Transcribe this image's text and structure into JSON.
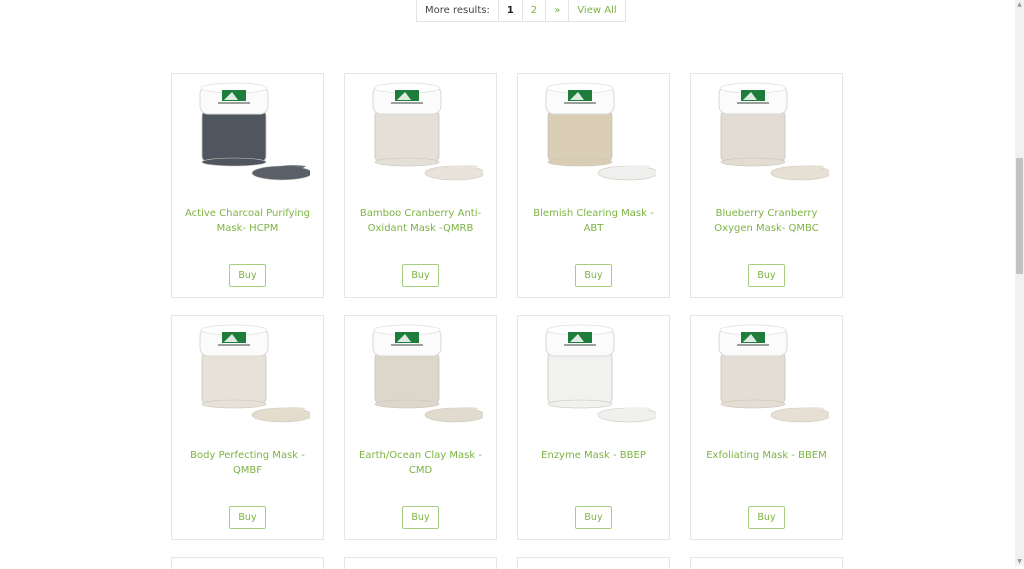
{
  "pager": {
    "label": "More results:",
    "current": "1",
    "page2": "2",
    "next": "»",
    "view_all": "View All"
  },
  "products": [
    {
      "title": "Active Charcoal Purifying Mask- HCPM",
      "buy": "Buy",
      "jar_color": "#4f5660",
      "swatch_color": "#5a6068"
    },
    {
      "title": "Bamboo Cranberry Anti-Oxidant Mask -QMRB",
      "buy": "Buy",
      "jar_color": "#e4e0d8",
      "swatch_color": "#e8e3d9"
    },
    {
      "title": "Blemish Clearing Mask - ABT",
      "buy": "Buy",
      "jar_color": "#d9cdb5",
      "swatch_color": "#eef0ee"
    },
    {
      "title": "Blueberry Cranberry Oxygen Mask- QMBC",
      "buy": "Buy",
      "jar_color": "#e2dcd2",
      "swatch_color": "#e6dfd3"
    },
    {
      "title": "Body Perfecting Mask - QMBF",
      "buy": "Buy",
      "jar_color": "#e6e2d8",
      "swatch_color": "#e3dccd"
    },
    {
      "title": "Earth/Ocean Clay Mask - CMD",
      "buy": "Buy",
      "jar_color": "#ddd6cb",
      "swatch_color": "#e1dbcf"
    },
    {
      "title": "Enzyme Mask - BBEP",
      "buy": "Buy",
      "jar_color": "#f1f1f0",
      "swatch_color": "#f0f0ee"
    },
    {
      "title": "Exfoliating Mask - BBEM",
      "buy": "Buy",
      "jar_color": "#e3ddd3",
      "swatch_color": "#e6e0d4"
    }
  ],
  "colors": {
    "accent": "#7cb342",
    "logo": "#1e7d3a"
  }
}
